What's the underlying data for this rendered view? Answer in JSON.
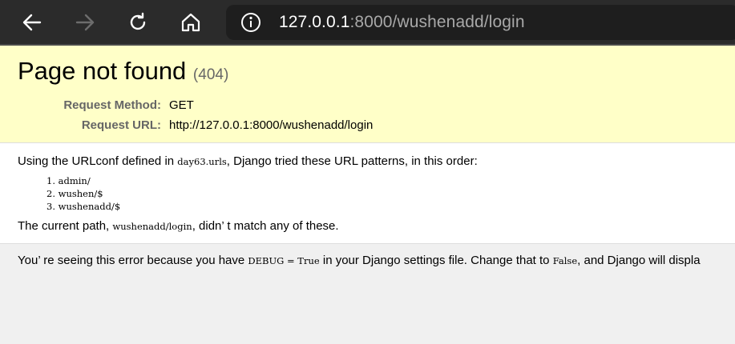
{
  "browser": {
    "url_host": "127.0.0.1",
    "url_rest": ":8000/wushenadd/login"
  },
  "error": {
    "title": "Page not found",
    "code": "(404)",
    "request_method_label": "Request Method:",
    "request_method_value": "GET",
    "request_url_label": "Request URL:",
    "request_url_value": "http://127.0.0.1:8000/wushenadd/login"
  },
  "info": {
    "urlconf_prefix": "Using the URLconf defined in ",
    "urlconf_module": "day63.urls",
    "urlconf_suffix": ", Django tried these URL patterns, in this order:",
    "patterns": [
      "1.  admin/",
      "2.  wushen/$",
      "3.  wushenadd/$"
    ],
    "current_prefix": "The current path, ",
    "current_path": "wushenadd/login",
    "current_suffix": ", didn’ t match any of these."
  },
  "explanation": {
    "part1": "You’ re seeing this error because you have ",
    "debug_code": "DEBUG = True",
    "part2": " in your Django settings file. Change that to ",
    "false_code": "False",
    "part3": ", and Django will displa"
  }
}
